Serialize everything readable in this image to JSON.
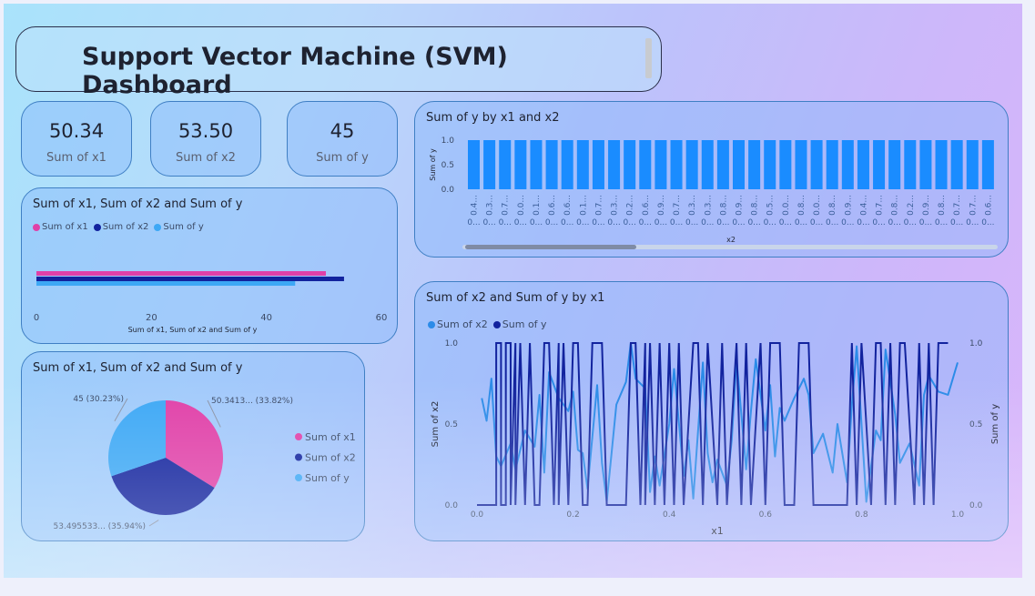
{
  "page": {
    "title": "Support Vector Machine (SVM) Dashboard"
  },
  "colors": {
    "x1": "#e040a8",
    "x2": "#12239e",
    "y": "#3da8f5",
    "line_x2": "#2b8be8",
    "bars": "#1a8cff"
  },
  "cards": [
    {
      "value": "50.34",
      "label": "Sum of x1"
    },
    {
      "value": "53.50",
      "label": "Sum of x2"
    },
    {
      "value": "45",
      "label": "Sum of y"
    }
  ],
  "legend": {
    "x1": "Sum of x1",
    "x2": "Sum of x2",
    "y": "Sum of y"
  },
  "chart_data": [
    {
      "type": "bar",
      "orientation": "horizontal",
      "title": "Sum of x1, Sum of x2 and Sum of y",
      "series": [
        {
          "name": "Sum of x1",
          "values": [
            50.34
          ]
        },
        {
          "name": "Sum of x2",
          "values": [
            53.5
          ]
        },
        {
          "name": "Sum of y",
          "values": [
            45
          ]
        }
      ],
      "xlim": [
        0,
        60
      ],
      "xticks": [
        "0",
        "20",
        "40",
        "60"
      ],
      "xlabel": "Sum of x1, Sum of x2 and Sum of y",
      "legend": "top-left"
    },
    {
      "type": "pie",
      "title": "Sum of x1, Sum of x2 and Sum of y",
      "slices": [
        {
          "name": "Sum of x1",
          "value": 50.3413,
          "label": "50.3413... (33.82%)"
        },
        {
          "name": "Sum of x2",
          "value": 53.495533,
          "label": "53.495533... (35.94%)"
        },
        {
          "name": "Sum of y",
          "value": 45,
          "label": "45 (30.23%)"
        }
      ],
      "legend": "right"
    },
    {
      "type": "bar",
      "title": "Sum of y by x1 and x2",
      "categories": [
        "0.4...",
        "0.3...",
        "0.7...",
        "0.0...",
        "0.1...",
        "0.6...",
        "0.6...",
        "0.1...",
        "0.7...",
        "0.3...",
        "0.2...",
        "0.6...",
        "0.9...",
        "0.7...",
        "0.3...",
        "0.3...",
        "0.8...",
        "0.9...",
        "0.8...",
        "0.5...",
        "0.0...",
        "0.8...",
        "0.0...",
        "0.8...",
        "0.9...",
        "0.4...",
        "0.7...",
        "0.8...",
        "0.2...",
        "0.9...",
        "0.8...",
        "0.7...",
        "0.7...",
        "0.6..."
      ],
      "secondary_labels": "0...",
      "values": [
        1,
        1,
        1,
        1,
        1,
        1,
        1,
        1,
        1,
        1,
        1,
        1,
        1,
        1,
        1,
        1,
        1,
        1,
        1,
        1,
        1,
        1,
        1,
        1,
        1,
        1,
        1,
        1,
        1,
        1,
        1,
        1,
        1,
        1
      ],
      "yticks": [
        "0.0",
        "0.5",
        "1.0"
      ],
      "ylim": [
        0,
        1
      ],
      "xlabel": "x2",
      "ylabel": "Sum of y"
    },
    {
      "type": "line",
      "title": "Sum of x2 and Sum of y by x1",
      "xlabel": "x1",
      "ylabel": "Sum of x2",
      "y2label": "Sum of y",
      "xlim": [
        0,
        1
      ],
      "ylim": [
        0,
        1
      ],
      "xticks": [
        "0.0",
        "0.2",
        "0.4",
        "0.6",
        "0.8",
        "1.0"
      ],
      "yticks": [
        "0.0",
        "0.5",
        "1.0"
      ],
      "y2ticks": [
        "0.0",
        "0.5",
        "1.0"
      ],
      "legend": "top-left",
      "series": [
        {
          "name": "Sum of x2",
          "x": [
            0.01,
            0.02,
            0.03,
            0.04,
            0.05,
            0.07,
            0.08,
            0.1,
            0.12,
            0.13,
            0.14,
            0.15,
            0.17,
            0.19,
            0.2,
            0.21,
            0.22,
            0.23,
            0.25,
            0.26,
            0.27,
            0.29,
            0.31,
            0.32,
            0.33,
            0.35,
            0.36,
            0.37,
            0.38,
            0.4,
            0.41,
            0.43,
            0.44,
            0.45,
            0.47,
            0.48,
            0.49,
            0.5,
            0.52,
            0.53,
            0.54,
            0.56,
            0.57,
            0.58,
            0.6,
            0.61,
            0.62,
            0.63,
            0.64,
            0.66,
            0.68,
            0.69,
            0.7,
            0.72,
            0.74,
            0.75,
            0.77,
            0.78,
            0.79,
            0.81,
            0.83,
            0.84,
            0.85,
            0.87,
            0.88,
            0.9,
            0.92,
            0.93,
            0.94,
            0.96,
            0.98,
            1.0
          ],
          "values": [
            0.66,
            0.52,
            0.78,
            0.3,
            0.24,
            0.38,
            0.22,
            0.46,
            0.36,
            0.68,
            0.2,
            0.82,
            0.66,
            0.58,
            0.7,
            0.34,
            0.32,
            0.1,
            0.74,
            0.26,
            0.02,
            0.62,
            0.76,
            1.0,
            0.78,
            0.72,
            0.08,
            0.3,
            0.12,
            0.5,
            0.84,
            0.18,
            0.4,
            0.04,
            0.88,
            0.32,
            0.14,
            0.28,
            0.12,
            0.4,
            0.9,
            0.22,
            0.58,
            0.9,
            0.46,
            0.74,
            0.3,
            0.6,
            0.52,
            0.66,
            0.78,
            0.68,
            0.32,
            0.44,
            0.2,
            0.5,
            0.14,
            0.62,
            0.98,
            0.02,
            0.46,
            0.4,
            0.96,
            0.56,
            0.26,
            0.38,
            0.12,
            0.68,
            0.8,
            0.7,
            0.68,
            0.88
          ]
        },
        {
          "name": "Sum of y",
          "x": [
            0.0,
            0.04,
            0.04,
            0.05,
            0.05,
            0.06,
            0.06,
            0.07,
            0.07,
            0.08,
            0.08,
            0.09,
            0.1,
            0.11,
            0.12,
            0.13,
            0.14,
            0.15,
            0.16,
            0.17,
            0.17,
            0.18,
            0.19,
            0.2,
            0.21,
            0.22,
            0.23,
            0.24,
            0.26,
            0.27,
            0.28,
            0.29,
            0.31,
            0.32,
            0.33,
            0.34,
            0.35,
            0.35,
            0.36,
            0.37,
            0.38,
            0.39,
            0.4,
            0.4,
            0.41,
            0.42,
            0.43,
            0.45,
            0.46,
            0.47,
            0.48,
            0.5,
            0.51,
            0.52,
            0.54,
            0.55,
            0.56,
            0.57,
            0.59,
            0.6,
            0.61,
            0.63,
            0.64,
            0.66,
            0.67,
            0.69,
            0.7,
            0.72,
            0.74,
            0.75,
            0.77,
            0.78,
            0.79,
            0.8,
            0.82,
            0.83,
            0.84,
            0.85,
            0.86,
            0.87,
            0.88,
            0.89,
            0.91,
            0.92,
            0.93,
            0.94,
            0.95,
            0.96,
            0.97,
            0.98
          ],
          "values": [
            0,
            0,
            1,
            1,
            0,
            0,
            1,
            1,
            0,
            1,
            0,
            1,
            0,
            1,
            0,
            0,
            1,
            1,
            0,
            1,
            0,
            1,
            0,
            1,
            1,
            0,
            0,
            1,
            1,
            0,
            0,
            0,
            0,
            1,
            1,
            0,
            1,
            0,
            1,
            0,
            1,
            0,
            1,
            1,
            0,
            1,
            0,
            1,
            1,
            0,
            1,
            0,
            1,
            0,
            1,
            0,
            1,
            0,
            1,
            0,
            1,
            1,
            0,
            0,
            1,
            1,
            0,
            0,
            0,
            0,
            0,
            1,
            0,
            1,
            0,
            1,
            1,
            0,
            1,
            0,
            1,
            1,
            0,
            1,
            0,
            1,
            0,
            1,
            1,
            1
          ]
        }
      ]
    }
  ]
}
